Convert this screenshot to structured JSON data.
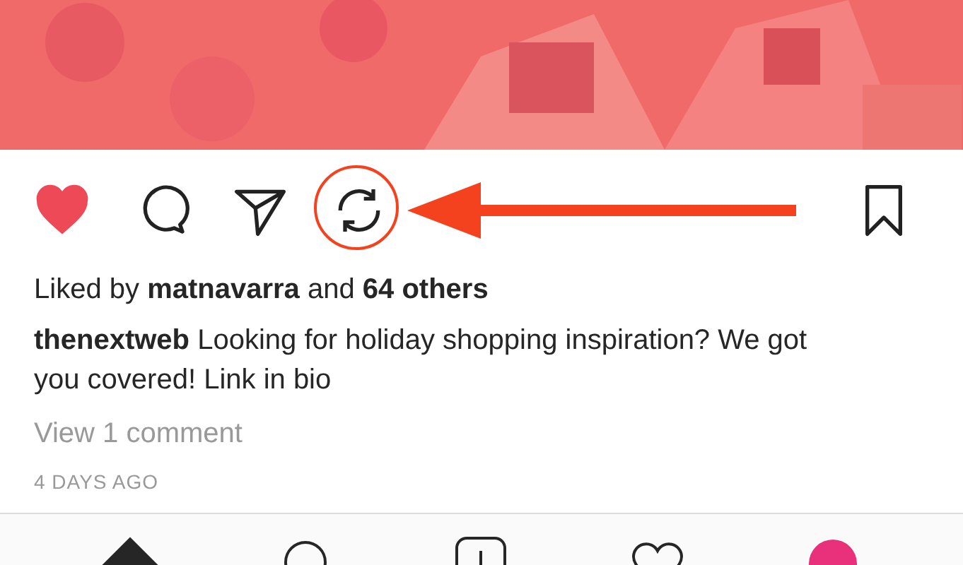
{
  "post": {
    "liked": true,
    "saved": false,
    "likes_text": "Liked by **matnavarra** and **64 others**",
    "caption": "**thenextweb** Looking for holiday shopping inspiration? We got you covered! Link in bio",
    "comments_link": "View 1 comment",
    "time": "4 DAYS AGO"
  },
  "annotation": {
    "repost_highlighted": true
  },
  "tab_bar": [
    {
      "kind": "home",
      "selected": true
    },
    {
      "kind": "search",
      "selected": false
    },
    {
      "kind": "add",
      "selected": false
    },
    {
      "kind": "activity",
      "selected": false
    },
    {
      "kind": "profile",
      "selected": false
    }
  ]
}
